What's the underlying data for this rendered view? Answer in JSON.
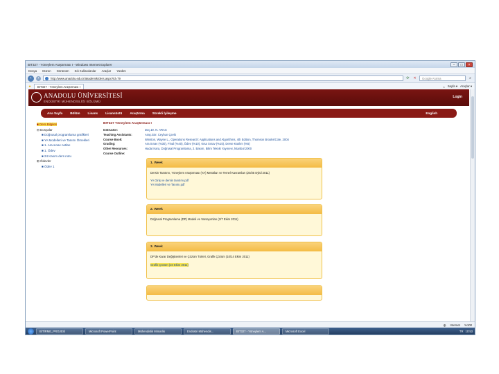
{
  "window": {
    "title": "BIT327 - Yöneylem Araştırması I - Windows Internet Explorer",
    "min": "–",
    "max": "□",
    "close": "×"
  },
  "menu": [
    "Dosya",
    "Düzen",
    "Görünüm",
    "Sık Kullanılanlar",
    "Araçlar",
    "Yardım"
  ],
  "address": {
    "url": "http://www.anadolu.edu.tr/akademik/ders.aspx?id=79",
    "search_placeholder": "Google Arama"
  },
  "favorites": {
    "tab_label": "BIT327 - Yöneylem Araştırması I",
    "tools": [
      "Sayfa ▾",
      "Araçlar ▾"
    ]
  },
  "site": {
    "logo_title": "ANADOLU ÜNİVERSİTESİ",
    "logo_subtitle": "ENDÜSTRİ MÜHENDİSLİĞİ BÖLÜMÜ",
    "login": "Login",
    "nav": [
      "Ana Sayfa",
      "Bölüm",
      "Lisans",
      "Lisansüstü",
      "Araştırma",
      "Sürekli İyileşme"
    ],
    "lang": "English"
  },
  "tree": {
    "items": [
      {
        "label": "■ Ders Bilgileri",
        "selected": true
      },
      {
        "label": "⊟ Dosyalar"
      },
      {
        "label": "■ Doğrusal programlama grafikleri",
        "child": true
      },
      {
        "label": "■ YA Modelleri ve Tanımı Örnekleri",
        "child": true
      },
      {
        "label": "■ 1. Ara sınav notları",
        "child": true
      },
      {
        "label": "■ 1. Ödev",
        "child": true
      },
      {
        "label": "■ 24 Kasım ders notu",
        "child": true
      },
      {
        "label": "⊞ Ödevler"
      },
      {
        "label": "■ Ödev 1",
        "child": true
      }
    ]
  },
  "course": {
    "title": "BIT327     Yöneylem Araştırması I",
    "info": [
      {
        "k": "Instructor:",
        "v": "Doç.Dr. N. ARAS"
      },
      {
        "k": "Teaching Assistants:",
        "v": "Araş.Gör. Ceyhun Çevik"
      },
      {
        "k": "Course Book:",
        "v": "Winston, Wayne L., Operations Research: Applications and Algorithms, 4th Edition, Thomson Brooks/Cole, 2004"
      },
      {
        "k": "Grading:",
        "v": "Ara Sınav (%30), Final (%40), Ödev (%10), Kısa Sınav (%15), Derse Katılım (%5)"
      },
      {
        "k": "Other Resources:",
        "v": "Hadat Kara, Doğrusal Programlama, 2. Basım, Bilim Teknik Yayınevi, İstanbul 2000"
      },
      {
        "k": "Course Outline:",
        "v": ""
      }
    ],
    "weeks": [
      {
        "title": "1. Week",
        "text": "Dersin Tanıtımı, Yöneylem Araştırması (YA) Metotları ve Temel Kavramları (20/25 Eylül 2011)",
        "links": [
          "YA Giriş ve dersin tanıtımı.pdf",
          "YA Modelleri ve Tanımı.pdf"
        ]
      },
      {
        "title": "2. Week",
        "text": "Doğrusal Programlama (DP) Modeli ve Varsayımları (2/7 Ekim 2011)",
        "links": []
      },
      {
        "title": "3. Week",
        "text": "DP'de Karar Değişkenleri ve Çözüm Türleri, Grafik Çözüm (10/14 Ekim 2011)",
        "links": [
          "Grafik Çözüm (10 Ekim 2011)"
        ]
      }
    ]
  },
  "status": {
    "zone": "Internet",
    "zoom": "%100"
  },
  "taskbar": {
    "items": [
      "BİTİRME_PROJESİ",
      "Microsoft PowerPoint",
      "Mühendislik Mimarlık",
      "Endüstri Mühendis...",
      "BIT327 - Yöneylem A...",
      "Microsoft Excel"
    ],
    "lang": "TR",
    "clock": "10:53"
  }
}
